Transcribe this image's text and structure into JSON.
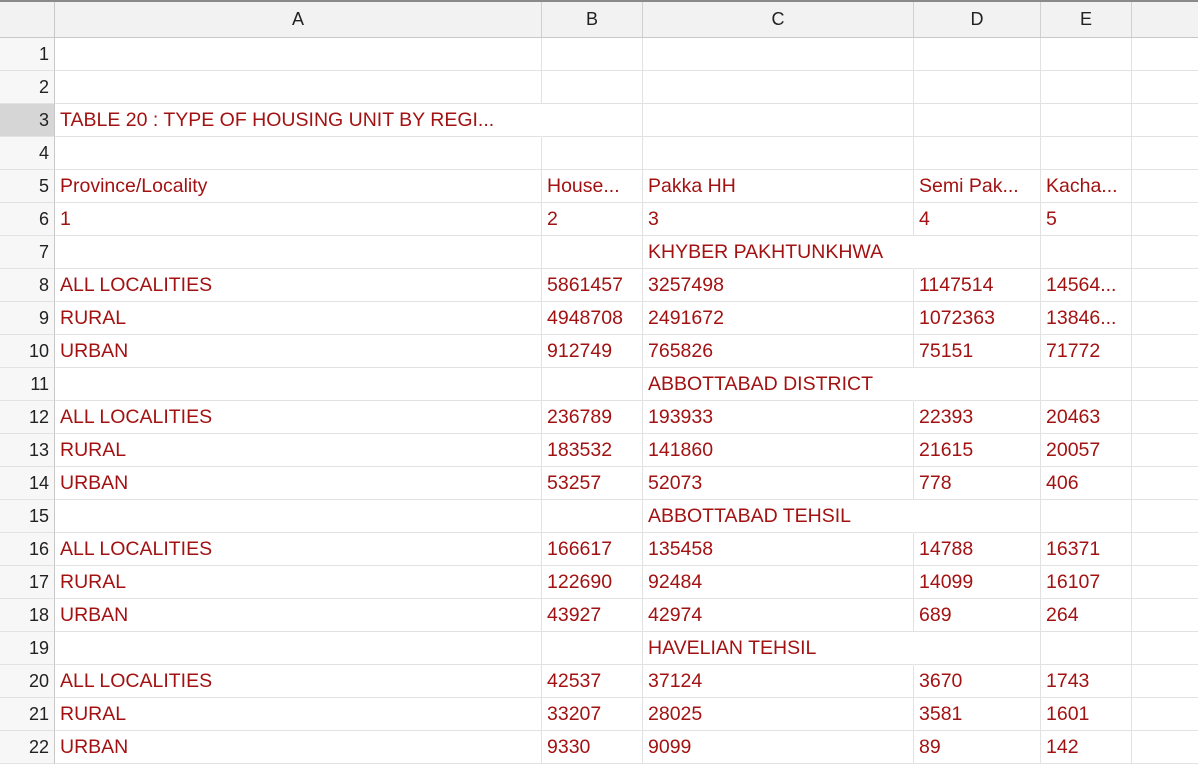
{
  "columns": [
    "A",
    "B",
    "C",
    "D",
    "E"
  ],
  "rows": [
    {
      "n": "1",
      "a": "",
      "b": "",
      "c": "",
      "d": "",
      "e": ""
    },
    {
      "n": "2",
      "a": "",
      "b": "",
      "c": "",
      "d": "",
      "e": ""
    },
    {
      "n": "3",
      "a": "TABLE 20 : TYPE OF HOUSING UNIT BY REGI...",
      "b": "",
      "c": "",
      "d": "",
      "e": ""
    },
    {
      "n": "4",
      "a": "",
      "b": "",
      "c": "",
      "d": "",
      "e": ""
    },
    {
      "n": "5",
      "a": "Province/Locality",
      "b": "House...",
      "c": "Pakka HH",
      "d": "Semi Pak...",
      "e": "Kacha..."
    },
    {
      "n": "6",
      "a": "1",
      "b": "2",
      "c": "3",
      "d": "4",
      "e": "5"
    },
    {
      "n": "7",
      "a": "",
      "b": "",
      "c": "KHYBER PAKHTUNKHWA",
      "d": "",
      "e": ""
    },
    {
      "n": "8",
      "a": "ALL LOCALITIES",
      "b": "5861457",
      "c": "3257498",
      "d": "1147514",
      "e": "14564..."
    },
    {
      "n": "9",
      "a": "RURAL",
      "b": "4948708",
      "c": "2491672",
      "d": "1072363",
      "e": "13846..."
    },
    {
      "n": "10",
      "a": "URBAN",
      "b": "912749",
      "c": "765826",
      "d": "75151",
      "e": "71772"
    },
    {
      "n": "11",
      "a": "",
      "b": "",
      "c": "ABBOTTABAD DISTRICT",
      "d": "",
      "e": ""
    },
    {
      "n": "12",
      "a": "ALL LOCALITIES",
      "b": "236789",
      "c": "193933",
      "d": "22393",
      "e": "20463"
    },
    {
      "n": "13",
      "a": "RURAL",
      "b": "183532",
      "c": "141860",
      "d": "21615",
      "e": "20057"
    },
    {
      "n": "14",
      "a": "URBAN",
      "b": "53257",
      "c": "52073",
      "d": "778",
      "e": "406"
    },
    {
      "n": "15",
      "a": "",
      "b": "",
      "c": "ABBOTTABAD TEHSIL",
      "d": "",
      "e": ""
    },
    {
      "n": "16",
      "a": "ALL LOCALITIES",
      "b": "166617",
      "c": "135458",
      "d": "14788",
      "e": "16371"
    },
    {
      "n": "17",
      "a": "RURAL",
      "b": "122690",
      "c": "92484",
      "d": "14099",
      "e": "16107"
    },
    {
      "n": "18",
      "a": "URBAN",
      "b": "43927",
      "c": "42974",
      "d": "689",
      "e": "264"
    },
    {
      "n": "19",
      "a": "",
      "b": "",
      "c": "HAVELIAN TEHSIL",
      "d": "",
      "e": ""
    },
    {
      "n": "20",
      "a": "ALL LOCALITIES",
      "b": "42537",
      "c": "37124",
      "d": "3670",
      "e": "1743"
    },
    {
      "n": "21",
      "a": "RURAL",
      "b": "33207",
      "c": "28025",
      "d": "3581",
      "e": "1601"
    },
    {
      "n": "22",
      "a": "URBAN",
      "b": "9330",
      "c": "9099",
      "d": "89",
      "e": "142"
    }
  ],
  "colors": {
    "text": "#a31212",
    "header_bg": "#f2f2f2",
    "gridline": "#e2e2e2"
  }
}
